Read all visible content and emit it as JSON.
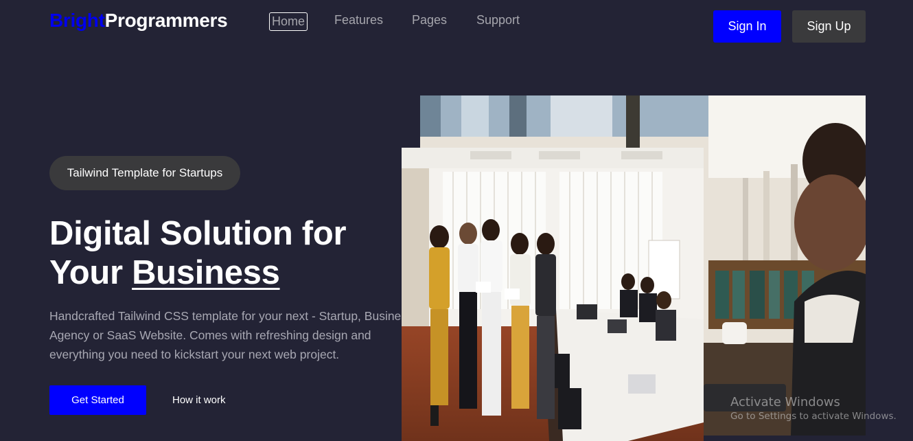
{
  "header": {
    "logo_part1": "Bright",
    "logo_part2": "Programmers",
    "nav": [
      "Home",
      "Features",
      "Pages",
      "Support"
    ],
    "active_nav": "Home",
    "sign_in": "Sign In",
    "sign_up": "Sign Up"
  },
  "hero": {
    "badge": "Tailwind Template for Startups",
    "title_line1": "Digital Solution for",
    "title_line2_prefix": "Your ",
    "title_line2_underlined": "Business",
    "description": "Handcrafted Tailwind CSS template for your next - Startup, Business, Agency or SaaS Website. Comes with refreshing design and everything you need to kickstart your next web project.",
    "primary_cta": "Get Started",
    "secondary_cta": "How it work"
  },
  "windows_watermark": {
    "line1": "Activate Windows",
    "line2": "Go to Settings to activate Windows."
  },
  "colors": {
    "background": "#232335",
    "accent_blue": "#0000ff",
    "muted_text": "#a8a8b3",
    "button_dark": "#3a3a3c"
  }
}
